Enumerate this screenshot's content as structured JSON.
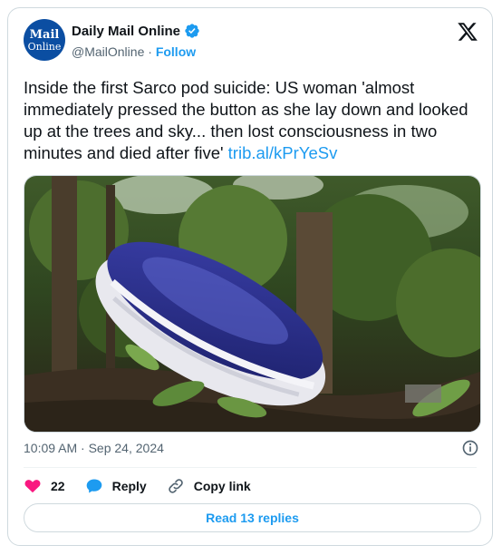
{
  "account": {
    "avatar_line1": "Mail",
    "avatar_line2": "Online",
    "display_name": "Daily Mail Online",
    "handle": "@MailOnline",
    "separator": " · ",
    "follow_label": "Follow"
  },
  "tweet": {
    "text": "Inside the first Sarco pod suicide: US woman 'almost immediately pressed the button as she lay down and looked up at the trees and sky... then lost consciousness in two minutes and died after five' ",
    "link_text": "trib.al/kPrYeSv",
    "timestamp": "10:09 AM · Sep 24, 2024"
  },
  "actions": {
    "likes_count": "22",
    "reply_label": "Reply",
    "copy_link_label": "Copy link"
  },
  "read_replies_label": "Read 13 replies",
  "colors": {
    "accent": "#1d9bf0",
    "like": "#f91880",
    "avatar_bg": "#0b4ea2",
    "pod_body": "#2a2f8c"
  },
  "icons": [
    "verified-badge-icon",
    "x-logo-icon",
    "info-icon",
    "heart-icon",
    "reply-bubble-icon",
    "link-icon"
  ]
}
